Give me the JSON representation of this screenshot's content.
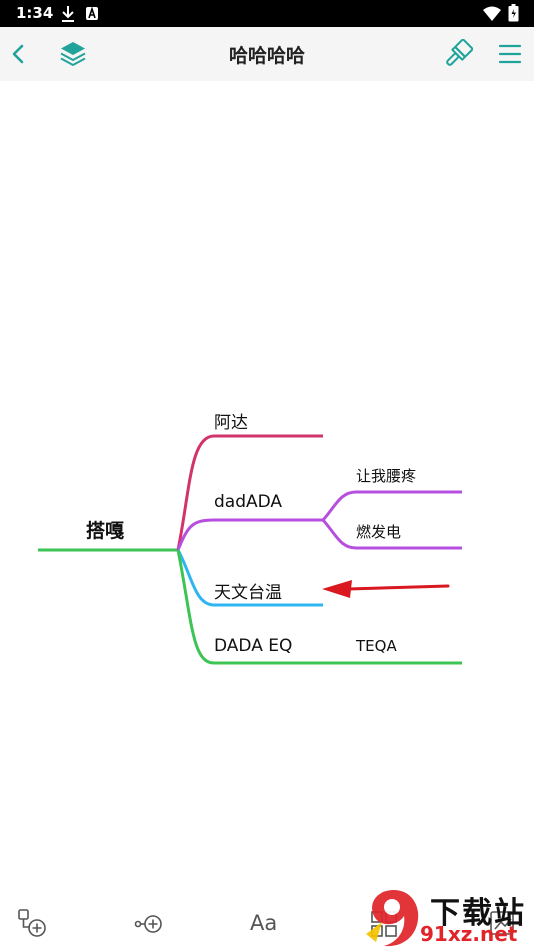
{
  "status_bar": {
    "time": "1:34",
    "icons": [
      "download-icon",
      "a-icon",
      "wifi-icon",
      "battery-icon"
    ]
  },
  "header": {
    "title": "哈哈哈哈",
    "icons": [
      "back-icon",
      "layers-icon",
      "brush-icon",
      "menu-icon"
    ],
    "accent_color": "#1fa39a"
  },
  "mindmap": {
    "root": "搭嘎",
    "branches": [
      {
        "label": "阿达",
        "color": "#d2336b",
        "children": []
      },
      {
        "label": "dadADA",
        "color": "#b64ee0",
        "children": [
          "让我腰疼",
          "燃发电"
        ]
      },
      {
        "label": "天文台温",
        "color": "#2fb5f0",
        "children": []
      },
      {
        "label": "DADA EQ",
        "color": "#3cc454",
        "children": [
          "TEQA"
        ]
      }
    ],
    "root_color": "#3cc454",
    "annotation_arrow_color": "#d9181f"
  },
  "toolbar": {
    "text_style_label": "Aa",
    "icons": [
      "add-subnode-icon",
      "add-sibling-icon",
      "text-style-icon",
      "layout-icon",
      "export-icon"
    ]
  },
  "watermark": {
    "main": "下载站",
    "sub": "91xz.net",
    "mark": "9"
  }
}
